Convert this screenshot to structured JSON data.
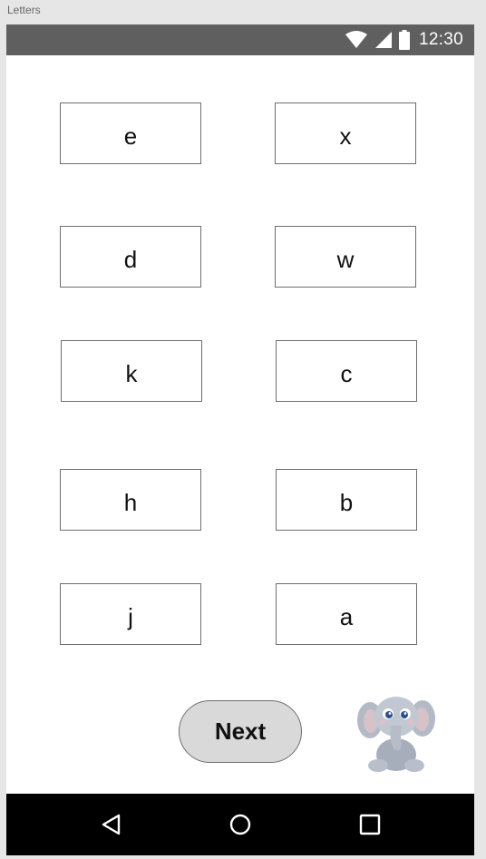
{
  "window": {
    "title": "Letters"
  },
  "status_bar": {
    "time": "12:30",
    "icons": [
      "wifi-icon",
      "signal-icon",
      "battery-icon"
    ]
  },
  "letters": [
    "e",
    "x",
    "d",
    "w",
    "k",
    "c",
    "h",
    "b",
    "j",
    "a"
  ],
  "next_button": {
    "label": "Next"
  },
  "mascot": {
    "icon": "elephant-icon"
  },
  "nav_bar": {
    "icons": [
      "back-icon",
      "home-icon",
      "recents-icon"
    ]
  },
  "colors": {
    "status_bar": "#5f5f5f",
    "nav_bar": "#000000",
    "button_fill": "#d9d9d9",
    "box_border": "#6e6e6e"
  }
}
